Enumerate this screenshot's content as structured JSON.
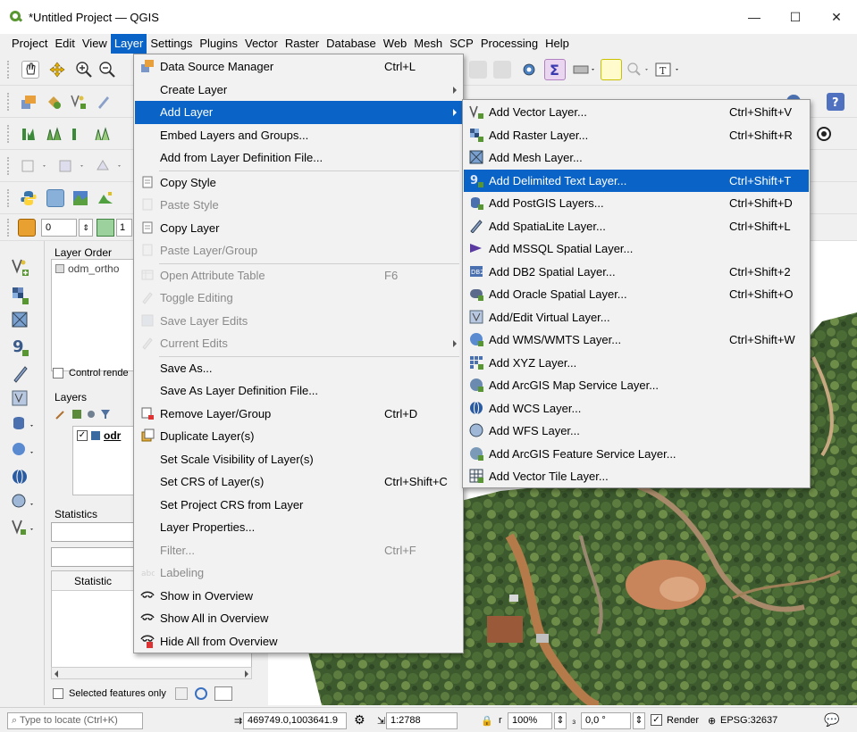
{
  "window": {
    "title": "*Untitled Project — QGIS",
    "minimize": "—",
    "maximize": "☐",
    "close": "✕"
  },
  "menubar": [
    "Project",
    "Edit",
    "View",
    "Layer",
    "Settings",
    "Plugins",
    "Vector",
    "Raster",
    "Database",
    "Web",
    "Mesh",
    "SCP",
    "Processing",
    "Help"
  ],
  "toolbar": {
    "spin_value": "0",
    "spin_value2": "1"
  },
  "panels": {
    "layer_order_title": "Layer Order",
    "layer_order_item": "odm_ortho",
    "control_render": "Control rende",
    "layers_title": "Layers",
    "layers_item": "odr",
    "statistics_title": "Statistics",
    "statistic_col": "Statistic",
    "selected_only": "Selected features only"
  },
  "layer_menu": [
    {
      "label": "Data Source Manager",
      "shortcut": "Ctrl+L",
      "icon": "data-source-icon",
      "state": "normal"
    },
    {
      "label": "Create Layer",
      "shortcut": "",
      "icon": "",
      "state": "submenu"
    },
    {
      "label": "Add Layer",
      "shortcut": "",
      "icon": "",
      "state": "highlighted"
    },
    {
      "label": "Embed Layers and Groups...",
      "shortcut": "",
      "icon": "",
      "state": "normal"
    },
    {
      "label": "Add from Layer Definition File...",
      "shortcut": "",
      "icon": "",
      "state": "normal"
    },
    {
      "label": "Copy Style",
      "shortcut": "",
      "icon": "copy-style-icon",
      "state": "normal"
    },
    {
      "label": "Paste Style",
      "shortcut": "",
      "icon": "paste-style-icon",
      "state": "disabled"
    },
    {
      "label": "Copy Layer",
      "shortcut": "",
      "icon": "copy-layer-icon",
      "state": "normal"
    },
    {
      "label": "Paste Layer/Group",
      "shortcut": "",
      "icon": "paste-layer-icon",
      "state": "disabled"
    },
    {
      "label": "Open Attribute Table",
      "shortcut": "F6",
      "icon": "attribute-table-icon",
      "state": "disabled"
    },
    {
      "label": "Toggle Editing",
      "shortcut": "",
      "icon": "pencil-icon",
      "state": "disabled"
    },
    {
      "label": "Save Layer Edits",
      "shortcut": "",
      "icon": "save-edits-icon",
      "state": "disabled"
    },
    {
      "label": "Current Edits",
      "shortcut": "",
      "icon": "current-edits-icon",
      "state": "disabled-submenu"
    },
    {
      "label": "Save As...",
      "shortcut": "",
      "icon": "",
      "state": "normal"
    },
    {
      "label": "Save As Layer Definition File...",
      "shortcut": "",
      "icon": "",
      "state": "normal"
    },
    {
      "label": "Remove Layer/Group",
      "shortcut": "Ctrl+D",
      "icon": "remove-layer-icon",
      "state": "normal"
    },
    {
      "label": "Duplicate Layer(s)",
      "shortcut": "",
      "icon": "duplicate-layer-icon",
      "state": "normal"
    },
    {
      "label": "Set Scale Visibility of Layer(s)",
      "shortcut": "",
      "icon": "",
      "state": "normal"
    },
    {
      "label": "Set CRS of Layer(s)",
      "shortcut": "Ctrl+Shift+C",
      "icon": "",
      "state": "normal"
    },
    {
      "label": "Set Project CRS from Layer",
      "shortcut": "",
      "icon": "",
      "state": "normal"
    },
    {
      "label": "Layer Properties...",
      "shortcut": "",
      "icon": "",
      "state": "normal"
    },
    {
      "label": "Filter...",
      "shortcut": "Ctrl+F",
      "icon": "",
      "state": "disabled"
    },
    {
      "label": "Labeling",
      "shortcut": "",
      "icon": "labeling-icon",
      "state": "disabled"
    },
    {
      "label": "Show in Overview",
      "shortcut": "",
      "icon": "overview-icon",
      "state": "normal"
    },
    {
      "label": "Show All in Overview",
      "shortcut": "",
      "icon": "overview-all-icon",
      "state": "normal"
    },
    {
      "label": "Hide All from Overview",
      "shortcut": "",
      "icon": "overview-hide-icon",
      "state": "normal"
    }
  ],
  "add_layer_submenu": [
    {
      "label": "Add Vector Layer...",
      "shortcut": "Ctrl+Shift+V",
      "icon": "vector-layer-icon",
      "state": "normal"
    },
    {
      "label": "Add Raster Layer...",
      "shortcut": "Ctrl+Shift+R",
      "icon": "raster-layer-icon",
      "state": "normal"
    },
    {
      "label": "Add Mesh Layer...",
      "shortcut": "",
      "icon": "mesh-layer-icon",
      "state": "normal"
    },
    {
      "label": "Add Delimited Text Layer...",
      "shortcut": "Ctrl+Shift+T",
      "icon": "delimited-text-icon",
      "state": "highlighted"
    },
    {
      "label": "Add PostGIS Layers...",
      "shortcut": "Ctrl+Shift+D",
      "icon": "postgis-icon",
      "state": "normal"
    },
    {
      "label": "Add SpatiaLite Layer...",
      "shortcut": "Ctrl+Shift+L",
      "icon": "spatialite-icon",
      "state": "normal"
    },
    {
      "label": "Add MSSQL Spatial Layer...",
      "shortcut": "",
      "icon": "mssql-icon",
      "state": "normal"
    },
    {
      "label": "Add DB2 Spatial Layer...",
      "shortcut": "Ctrl+Shift+2",
      "icon": "db2-icon",
      "state": "normal"
    },
    {
      "label": "Add Oracle Spatial Layer...",
      "shortcut": "Ctrl+Shift+O",
      "icon": "oracle-icon",
      "state": "normal"
    },
    {
      "label": "Add/Edit Virtual Layer...",
      "shortcut": "",
      "icon": "virtual-layer-icon",
      "state": "normal"
    },
    {
      "label": "Add WMS/WMTS Layer...",
      "shortcut": "Ctrl+Shift+W",
      "icon": "wms-icon",
      "state": "normal"
    },
    {
      "label": "Add XYZ Layer...",
      "shortcut": "",
      "icon": "xyz-icon",
      "state": "normal"
    },
    {
      "label": "Add ArcGIS Map Service Layer...",
      "shortcut": "",
      "icon": "arcgis-map-icon",
      "state": "normal"
    },
    {
      "label": "Add WCS Layer...",
      "shortcut": "",
      "icon": "wcs-icon",
      "state": "normal"
    },
    {
      "label": "Add WFS Layer...",
      "shortcut": "",
      "icon": "wfs-icon",
      "state": "normal"
    },
    {
      "label": "Add ArcGIS Feature Service Layer...",
      "shortcut": "",
      "icon": "arcgis-feature-icon",
      "state": "normal"
    },
    {
      "label": "Add Vector Tile Layer...",
      "shortcut": "",
      "icon": "vector-tile-icon",
      "state": "normal"
    }
  ],
  "statusbar": {
    "locate_placeholder": "Type to locate (Ctrl+K)",
    "coordinate": "469749.0,1003641.9",
    "scale": "1:2788",
    "magnifier": "100%",
    "rotation": "0,0 °",
    "render": "Render",
    "crs": "EPSG:32637"
  },
  "colors": {
    "highlight": "#0a64c8",
    "qgis_green": "#589632"
  }
}
